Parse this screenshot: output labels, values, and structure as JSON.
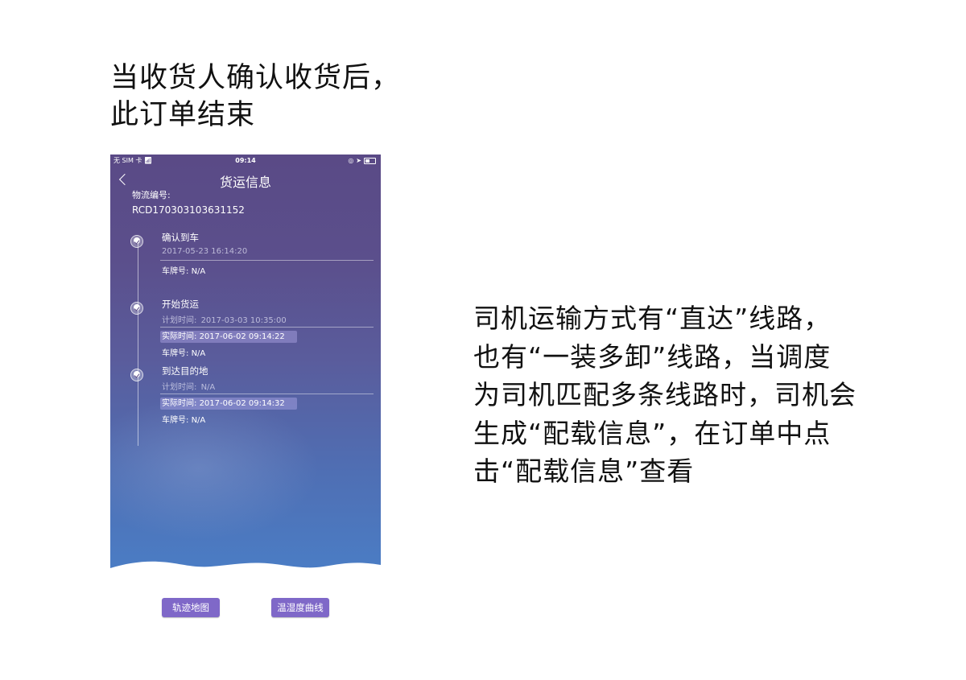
{
  "captions": {
    "top": [
      "当收货人确认收货后，",
      "此订单结束"
    ],
    "right": [
      "司机运输方式有“直达”线路，",
      "也有“一装多卸”线路，当调度",
      "为司机匹配多条线路时，司机会",
      "生成“配载信息”，在订单中点",
      "击“配载信息”查看"
    ]
  },
  "status_bar": {
    "carrier": "无 SIM 卡",
    "time": "09:14"
  },
  "nav": {
    "title": "货运信息"
  },
  "order": {
    "label": "物流编号:",
    "number": "RCD170303103631152"
  },
  "steps": [
    {
      "title": "确认到车",
      "time": "2017-05-23 16:14:20",
      "plate_label": "车牌号:",
      "plate": "N/A"
    },
    {
      "title": "开始货运",
      "planned_label": "计划时间:",
      "planned": "2017-03-03 10:35:00",
      "actual_label": "实际时间:",
      "actual": "2017-06-02 09:14:22",
      "plate_label": "车牌号:",
      "plate": "N/A"
    },
    {
      "title": "到达目的地",
      "planned_label": "计划时间:",
      "planned": "N/A",
      "actual_label": "实际时间:",
      "actual": "2017-06-02 09:14:32",
      "plate_label": "车牌号:",
      "plate": "N/A"
    }
  ],
  "buttons": {
    "track_map": "轨迹地图",
    "temp_curve": "温湿度曲线"
  },
  "colors": {
    "button": "#7f68c8",
    "bg_top": "#5a4a86",
    "bg_bottom": "#4a7ec6"
  }
}
